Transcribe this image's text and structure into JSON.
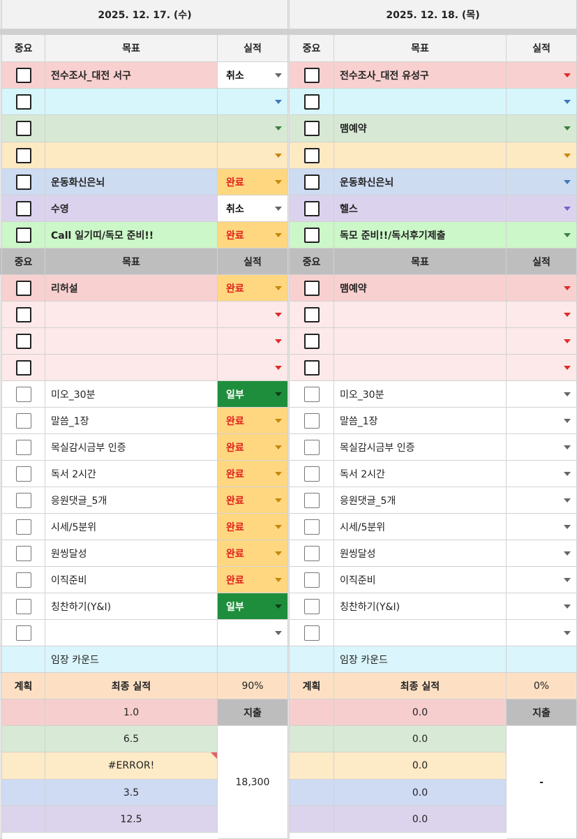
{
  "days": [
    {
      "date": "2025. 12. 17. (수)"
    },
    {
      "date": "2025. 12. 18. (목)"
    }
  ],
  "headers": {
    "importance": "중요",
    "goal": "목표",
    "result": "실적"
  },
  "colors": {
    "red_row": "#f9d0d0",
    "cyan_row": "#d6f6fb",
    "green_row": "#d7e9d4",
    "yellow_row": "#fde9c2",
    "blue_row": "#cedcf2",
    "purple_row": "#dbd3ee",
    "lightgreen_row": "#ccf7c8",
    "pink_row": "#fde9e9",
    "done_badge": "#ffd781",
    "done_text": "#e0201a",
    "partial_badge": "#1f8e3c",
    "arrow_red": "#e02b2b",
    "arrow_blue": "#3e78b8",
    "arrow_green": "#3d7f42",
    "arrow_orange": "#c8860b",
    "arrow_purple": "#7c5fc8",
    "arrow_gray": "#666666"
  },
  "section1": [
    {
      "color": "red_row",
      "goal_l": "전수조사_대전 서구",
      "result_l": "취소",
      "arrow_l": "arrow_gray",
      "goal_r": "전수조사_대전 유성구",
      "result_r": "",
      "arrow_r": "arrow_red"
    },
    {
      "color": "cyan_row",
      "goal_l": "",
      "result_l": "",
      "arrow_l": "arrow_blue",
      "goal_r": "",
      "result_r": "",
      "arrow_r": "arrow_blue"
    },
    {
      "color": "green_row",
      "goal_l": "",
      "result_l": "",
      "arrow_l": "arrow_green",
      "goal_r": "맴예약",
      "result_r": "",
      "arrow_r": "arrow_green"
    },
    {
      "color": "yellow_row",
      "goal_l": "",
      "result_l": "",
      "arrow_l": "arrow_orange",
      "goal_r": "",
      "result_r": "",
      "arrow_r": "arrow_orange"
    },
    {
      "color": "blue_row",
      "goal_l": "운동화신은뇌",
      "result_l": "완료",
      "arrow_l": "arrow_orange",
      "goal_r": "운동화신은뇌",
      "result_r": "",
      "arrow_r": "arrow_blue"
    },
    {
      "color": "purple_row",
      "goal_l": "수영",
      "result_l": "취소",
      "arrow_l": "arrow_gray",
      "goal_r": "헬스",
      "result_r": "",
      "arrow_r": "arrow_purple"
    },
    {
      "color": "lightgreen_row",
      "goal_l": "Call 일기띠/독모 준비!!",
      "result_l": "완료",
      "arrow_l": "arrow_orange",
      "goal_r": "독모 준비!!/독서후기제출",
      "result_r": "",
      "arrow_r": "arrow_green"
    }
  ],
  "section2_pink": [
    {
      "goal_l": "리허설",
      "result_l": "완료",
      "goal_r": "맴예약"
    },
    {
      "goal_l": "",
      "result_l": "",
      "goal_r": ""
    },
    {
      "goal_l": "",
      "result_l": "",
      "goal_r": ""
    },
    {
      "goal_l": "",
      "result_l": "",
      "goal_r": ""
    }
  ],
  "section2_plain": [
    {
      "goal_l": "미오_30분",
      "result_l": "일부",
      "goal_r": "미오_30분"
    },
    {
      "goal_l": "말씀_1장",
      "result_l": "완료",
      "goal_r": "말씀_1장"
    },
    {
      "goal_l": "목실감시금부 인증",
      "result_l": "완료",
      "goal_r": "목실감시금부 인증"
    },
    {
      "goal_l": "독서 2시간",
      "result_l": "완료",
      "goal_r": "독서 2시간"
    },
    {
      "goal_l": "응원댓글_5개",
      "result_l": "완료",
      "goal_r": "응원댓글_5개"
    },
    {
      "goal_l": "시세/5분위",
      "result_l": "완료",
      "goal_r": "시세/5분위"
    },
    {
      "goal_l": "원씽달성",
      "result_l": "완료",
      "goal_r": "원씽달성"
    },
    {
      "goal_l": "이직준비",
      "result_l": "완료",
      "goal_r": "이직준비"
    },
    {
      "goal_l": "칭찬하기(Y&I)",
      "result_l": "일부",
      "goal_r": "칭찬하기(Y&I)"
    },
    {
      "goal_l": "",
      "result_l": "",
      "goal_r": ""
    }
  ],
  "counter_label": "임장 카운드",
  "summary": {
    "plan_label": "계획",
    "final_label": "최종 실적",
    "left_pct": "90%",
    "right_pct": "0%",
    "spend_label": "지출",
    "left_values": [
      "1.0",
      "6.5",
      "#ERROR!",
      "3.5",
      "12.5"
    ],
    "right_values": [
      "0.0",
      "0.0",
      "0.0",
      "0.0",
      "0.0"
    ],
    "left_total": "18,300",
    "right_total": "-",
    "row_colors": [
      "#f6cece",
      "#d8ead5",
      "#fdeac6",
      "#cfdaf3",
      "#dcd4ec"
    ]
  }
}
